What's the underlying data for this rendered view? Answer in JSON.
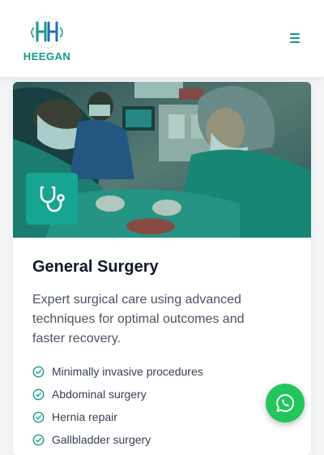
{
  "header": {
    "brand": "HEEGAN",
    "menu_icon": "hamburger-menu-icon"
  },
  "card": {
    "image_alt": "Surgeons performing an operation",
    "badge_icon": "stethoscope-icon",
    "title": "General Surgery",
    "description": "Expert surgical care using advanced techniques for optimal outcomes and faster recovery.",
    "features": [
      "Minimally invasive procedures",
      "Abdominal surgery",
      "Hernia repair",
      "Gallbladder surgery"
    ]
  },
  "floating": {
    "whatsapp_icon": "whatsapp-icon"
  },
  "colors": {
    "brand": "#159a87",
    "badge": "#16a591",
    "whatsapp": "#23c65d"
  }
}
